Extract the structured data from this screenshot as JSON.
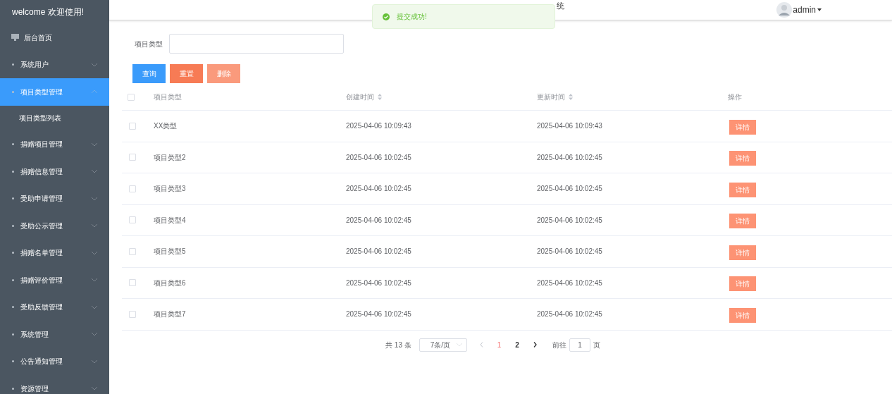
{
  "sidebar": {
    "welcome": "welcome 欢迎使用!",
    "items": [
      {
        "label": "后台首页",
        "kind": "home",
        "selected": false
      },
      {
        "label": "系统用户",
        "kind": "menu",
        "selected": false,
        "expanded": false
      },
      {
        "label": "项目类型管理",
        "kind": "menu",
        "selected": true,
        "expanded": true,
        "children": [
          {
            "label": "项目类型列表"
          }
        ]
      },
      {
        "label": "捐赠项目管理",
        "kind": "menu",
        "selected": false,
        "expanded": false
      },
      {
        "label": "捐赠信息管理",
        "kind": "menu",
        "selected": false,
        "expanded": false
      },
      {
        "label": "受助申请管理",
        "kind": "menu",
        "selected": false,
        "expanded": false
      },
      {
        "label": "受助公示管理",
        "kind": "menu",
        "selected": false,
        "expanded": false
      },
      {
        "label": "捐赠名单管理",
        "kind": "menu",
        "selected": false,
        "expanded": false
      },
      {
        "label": "捐赠评价管理",
        "kind": "menu",
        "selected": false,
        "expanded": false
      },
      {
        "label": "受助反馈管理",
        "kind": "menu",
        "selected": false,
        "expanded": false
      },
      {
        "label": "系统管理",
        "kind": "menu",
        "selected": false,
        "expanded": false
      },
      {
        "label": "公告通知管理",
        "kind": "menu",
        "selected": false,
        "expanded": false
      },
      {
        "label": "资源管理",
        "kind": "menu",
        "selected": false,
        "expanded": false
      }
    ]
  },
  "header": {
    "title": "统",
    "user": "admin"
  },
  "toast": {
    "message": "提交成功!"
  },
  "search": {
    "label": "项目类型"
  },
  "buttons": [
    {
      "label": "查询",
      "kind": "primary",
      "disabled": false
    },
    {
      "label": "重置",
      "kind": "danger",
      "disabled": false
    },
    {
      "label": "删除",
      "kind": "danger",
      "disabled": true
    }
  ],
  "table": {
    "all_checked": false,
    "columns": [
      {
        "label": "项目类型",
        "sortable": false
      },
      {
        "label": "创建时间",
        "sortable": true
      },
      {
        "label": "更新时间",
        "sortable": true
      },
      {
        "label": "操作",
        "sortable": false
      }
    ],
    "rows": [
      {
        "checked": false,
        "type": "XX类型",
        "created": "2025-04-06 10:09:43",
        "updated": "2025-04-06 10:09:43",
        "action": "详情"
      },
      {
        "checked": false,
        "type": "项目类型2",
        "created": "2025-04-06 10:02:45",
        "updated": "2025-04-06 10:02:45",
        "action": "详情"
      },
      {
        "checked": false,
        "type": "项目类型3",
        "created": "2025-04-06 10:02:45",
        "updated": "2025-04-06 10:02:45",
        "action": "详情"
      },
      {
        "checked": false,
        "type": "项目类型4",
        "created": "2025-04-06 10:02:45",
        "updated": "2025-04-06 10:02:45",
        "action": "详情"
      },
      {
        "checked": false,
        "type": "项目类型5",
        "created": "2025-04-06 10:02:45",
        "updated": "2025-04-06 10:02:45",
        "action": "详情"
      },
      {
        "checked": false,
        "type": "项目类型6",
        "created": "2025-04-06 10:02:45",
        "updated": "2025-04-06 10:02:45",
        "action": "详情"
      },
      {
        "checked": false,
        "type": "项目类型7",
        "created": "2025-04-06 10:02:45",
        "updated": "2025-04-06 10:02:45",
        "action": "详情"
      }
    ]
  },
  "pagination": {
    "total": "共 13 条",
    "page_size": "7条/页",
    "pages": [
      {
        "label": "1",
        "selected": true
      },
      {
        "label": "2",
        "selected": false
      }
    ],
    "goto_label": "前往",
    "goto_value": "1",
    "goto_suffix": "页"
  }
}
